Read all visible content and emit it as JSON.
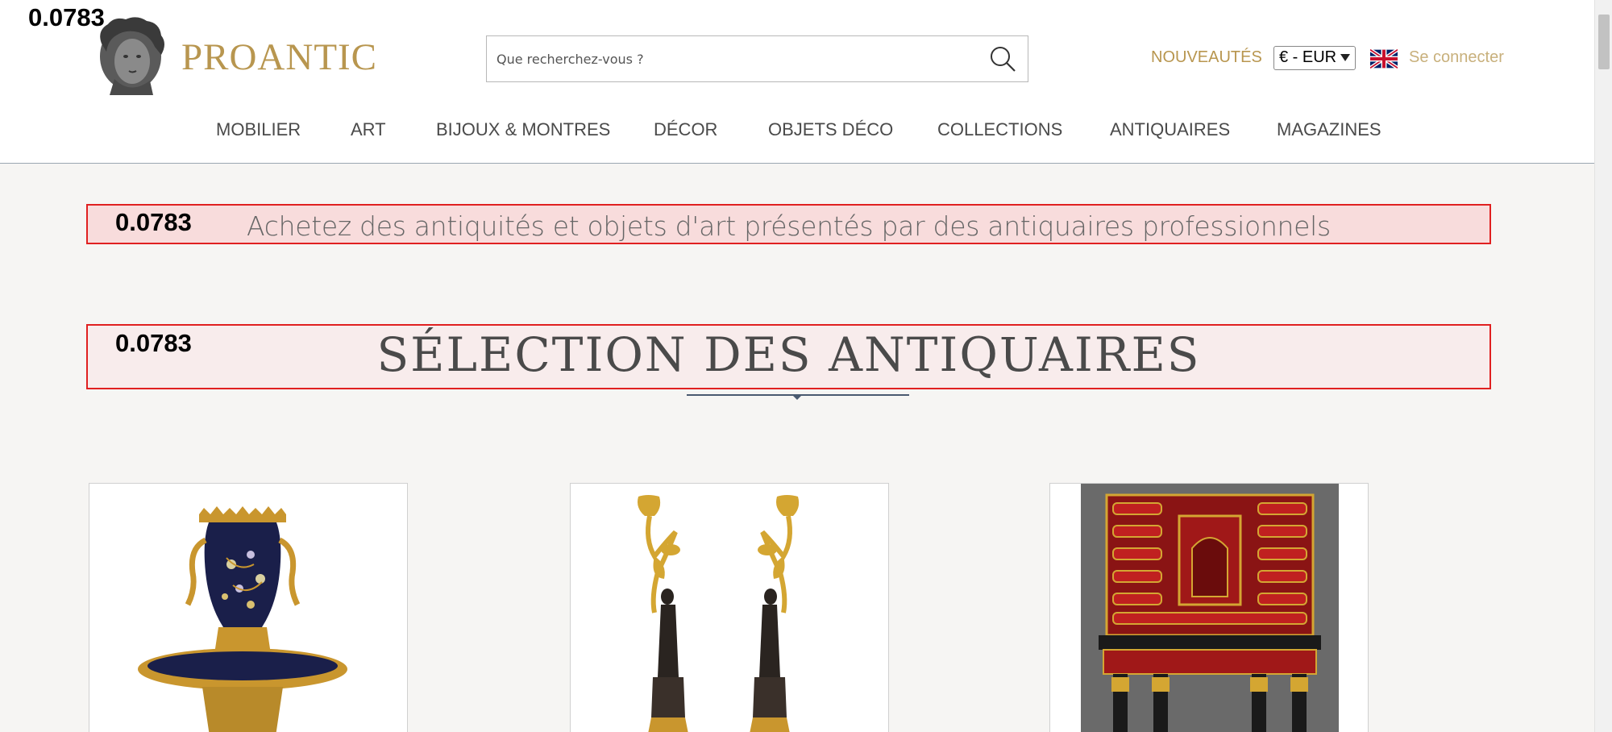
{
  "overlay": {
    "score": "0.0783"
  },
  "brand": {
    "name": "PROANTIC"
  },
  "search": {
    "placeholder": "Que recherchez-vous ?"
  },
  "header_links": {
    "new_items": "NOUVEAUTÉS",
    "currency": "€ - EUR",
    "login": "Se connecter"
  },
  "nav": {
    "items": [
      "MOBILIER",
      "ART",
      "BIJOUX & MONTRES",
      "DÉCOR",
      "OBJETS DÉCO",
      "COLLECTIONS",
      "ANTIQUAIRES",
      "MAGAZINES"
    ]
  },
  "banner": {
    "text": "Achetez des antiquités et objets d'art présentés par des antiquaires professionnels"
  },
  "section": {
    "title": "SÉLECTION DES ANTIQUAIRES"
  },
  "colors": {
    "gold": "#b8964f",
    "highlight_border": "#e02020",
    "highlight_fill": "#f8dcdc"
  },
  "icons": [
    "search-icon",
    "uk-flag-icon",
    "select-caret-icon"
  ]
}
